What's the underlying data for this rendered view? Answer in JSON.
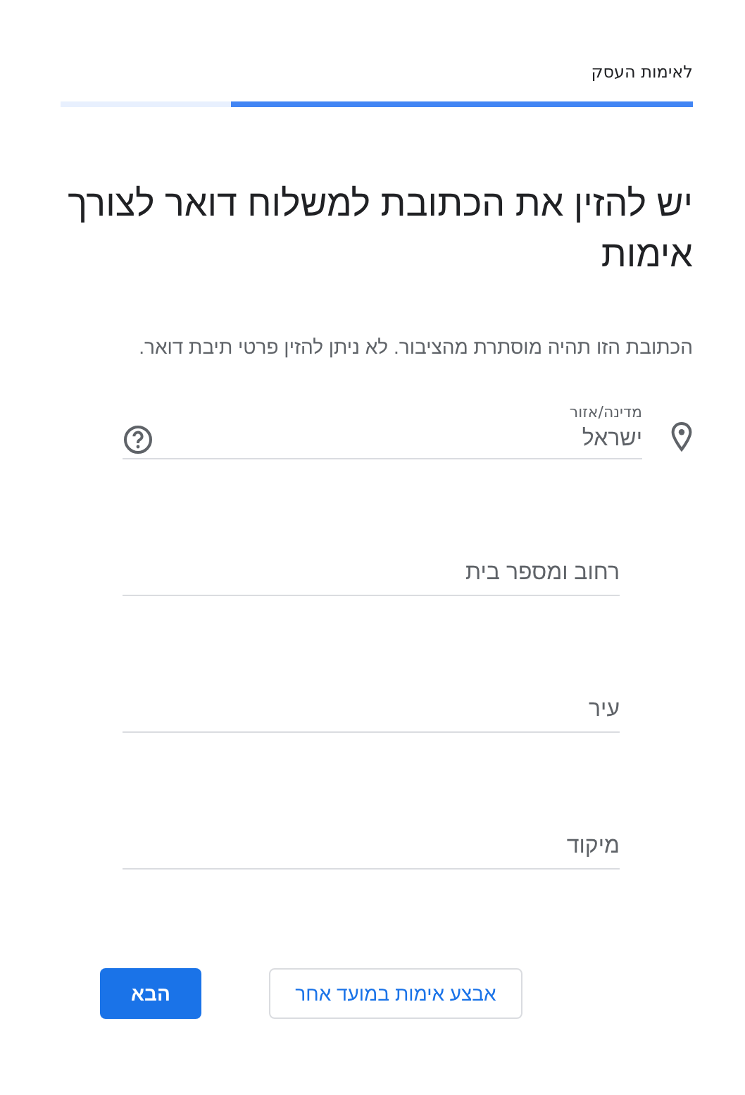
{
  "header": {
    "title": "לאימות העסק"
  },
  "progress": {
    "level": 0.73
  },
  "heading": "יש להזין את הכתובת למשלוח דואר לצורך אימות",
  "description": "הכתובת הזו תהיה מוסתרת מהציבור. לא ניתן להזין פרטי תיבת דואר.",
  "country_field": {
    "label": "מדינה/אזור",
    "value": "ישראל"
  },
  "fields": [
    {
      "placeholder": "רחוב ומספר בית"
    },
    {
      "placeholder": "עיר"
    },
    {
      "placeholder": "מיקוד"
    }
  ],
  "buttons": [
    {
      "label": "אבצע אימות במועד אחר",
      "kind": "secondary"
    },
    {
      "label": "הבא",
      "kind": "primary"
    }
  ]
}
